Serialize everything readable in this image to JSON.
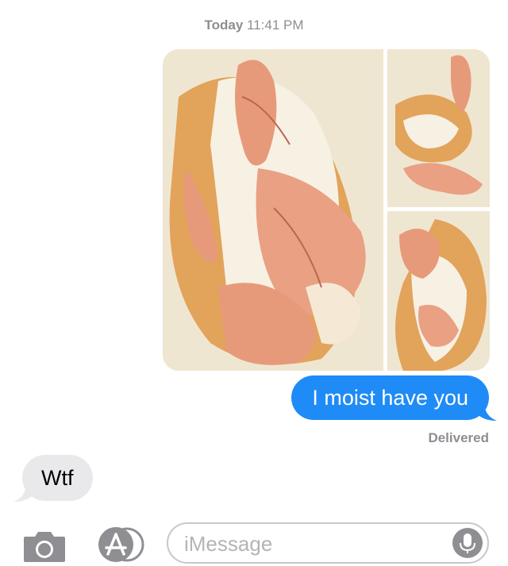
{
  "header": {
    "day": "Today",
    "time": "11:41 PM"
  },
  "messages": {
    "outgoing_text": "I moist have you",
    "status": "Delivered",
    "incoming_text": "Wtf"
  },
  "input": {
    "placeholder": "iMessage"
  },
  "colors": {
    "outgoing_bubble": "#1f8bf6",
    "incoming_bubble": "#e9e9eb",
    "meta_text": "#8e8e93"
  },
  "icons": {
    "camera": "camera-icon",
    "apps": "app-store-icon",
    "mic": "microphone-icon"
  }
}
